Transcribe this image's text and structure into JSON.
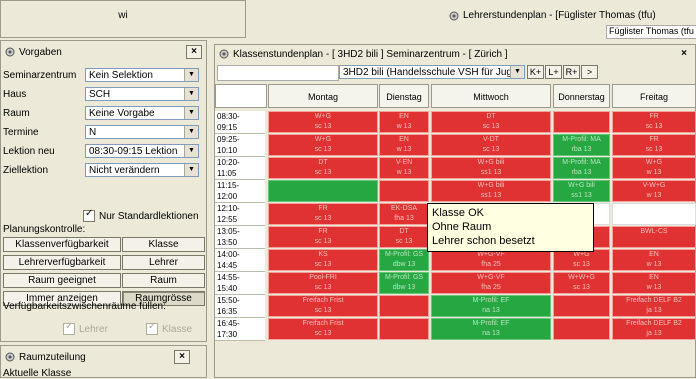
{
  "top_left": {
    "value": "wi"
  },
  "top_right": {
    "title": "Lehrerstundenplan - [Füglister Thomas (tfu)",
    "field": "Füglister Thomas (tfu"
  },
  "vorgaben": {
    "title": "Vorgaben",
    "fields": [
      {
        "label": "Seminarzentrum",
        "value": "Kein Selektion"
      },
      {
        "label": "Haus",
        "value": "SCH"
      },
      {
        "label": "Raum",
        "value": "Keine Vorgabe"
      },
      {
        "label": "Termine",
        "value": "N"
      },
      {
        "label": "Lektion neu",
        "value": "08:30-09:15 Lektion"
      },
      {
        "label": "Ziellektion",
        "value": "Nicht verändern"
      }
    ],
    "only_standard_label": "Nur Standardlektionen",
    "planungskontrolle_label": "Planungskontrolle:",
    "buttons": [
      [
        "Klassenverfügbarkeit",
        "Klasse"
      ],
      [
        "Lehrerverfügbarkeit",
        "Lehrer"
      ],
      [
        "Raum geeignet",
        "Raum"
      ],
      [
        "Immer anzeigen",
        "Raumgrösse"
      ]
    ],
    "verfuegbarkeit_label": "Verfügbarkeitszwischenräume füllen:",
    "check_lehrer": "Lehrer",
    "check_klasse": "Klasse"
  },
  "raumzuteilung": {
    "title": "Raumzuteilung",
    "aktuelle": "Aktuelle Klasse"
  },
  "klasse": {
    "title": "Klassenstundenplan - [ 3HD2 bili ] Seminarzentrum - [ Zürich ]",
    "select": "3HD2 bili (Handelsschule VSH für Jug",
    "nav": [
      "K+",
      "L+",
      "R+",
      ">"
    ],
    "days": [
      "Montag",
      "Dienstag",
      "Mittwoch",
      "Donnerstag",
      "Freitag"
    ],
    "times": [
      [
        "08:30-",
        "09:15"
      ],
      [
        "09:25-",
        "10:10"
      ],
      [
        "10:20-",
        "11:05"
      ],
      [
        "11:15-",
        "12:00"
      ],
      [
        "12:10-",
        "12:55"
      ],
      [
        "13:05-",
        "13:50"
      ],
      [
        "14:00-",
        "14:45"
      ],
      [
        "14:55-",
        "15:40"
      ],
      [
        "15:50-",
        "16:35"
      ],
      [
        "16:45-",
        "17:30"
      ]
    ],
    "tooltip": [
      "Klasse OK",
      "Ohne Raum",
      "Lehrer schon besetzt"
    ]
  },
  "cells": [
    [
      "W+G|sc 13",
      "EN|w 13",
      "DT|sc 13",
      "",
      "FR|sc 13"
    ],
    [
      "W+G|sc 13",
      "EN|w 13",
      "V-DT|sc 13",
      "M-Profil: MA|rba 13",
      "FR|sc 13"
    ],
    [
      "DT|sc 13",
      "V-EN|w 13",
      "W+G bili|ss1 13",
      "M-Profil: MA|rba 13",
      "W+G|w 13"
    ],
    [
      "",
      "",
      "W+G bili|ss1 13",
      "W+G bili|ss1 13",
      "V-W+G|w 13"
    ],
    [
      "FR|sc 13",
      "EK-DSA|fha 13",
      "",
      "",
      ""
    ],
    [
      "FR|sc 13",
      "DT|sc 13",
      "W+G-VF|fha 25",
      "",
      "BWL-CS"
    ],
    [
      "KS|sc 13",
      "M-Profil: GS|dbw 13",
      "W+G-VF|fha 25",
      "W+G|sc 13",
      "EN|w 13"
    ],
    [
      "Pool-FRI|sc 13",
      "M-Profil: GS|dbw 13",
      "W+G-VF|fha 25",
      "W+W+G|sc 13",
      "EN|w 13"
    ],
    [
      "Freifach Frist|sc 13",
      "",
      "M-Profil: EF|na 13",
      "",
      "Freifach DELF B2|ja 13"
    ],
    [
      "Freifach Frist|sc 13",
      "",
      "M-Profil: EF|na 13",
      "",
      "Freifach DELF B2|ja 13"
    ]
  ],
  "colors": {
    "red": "#e03232",
    "green": "#27a742",
    "chrome": "#ece9d8"
  }
}
